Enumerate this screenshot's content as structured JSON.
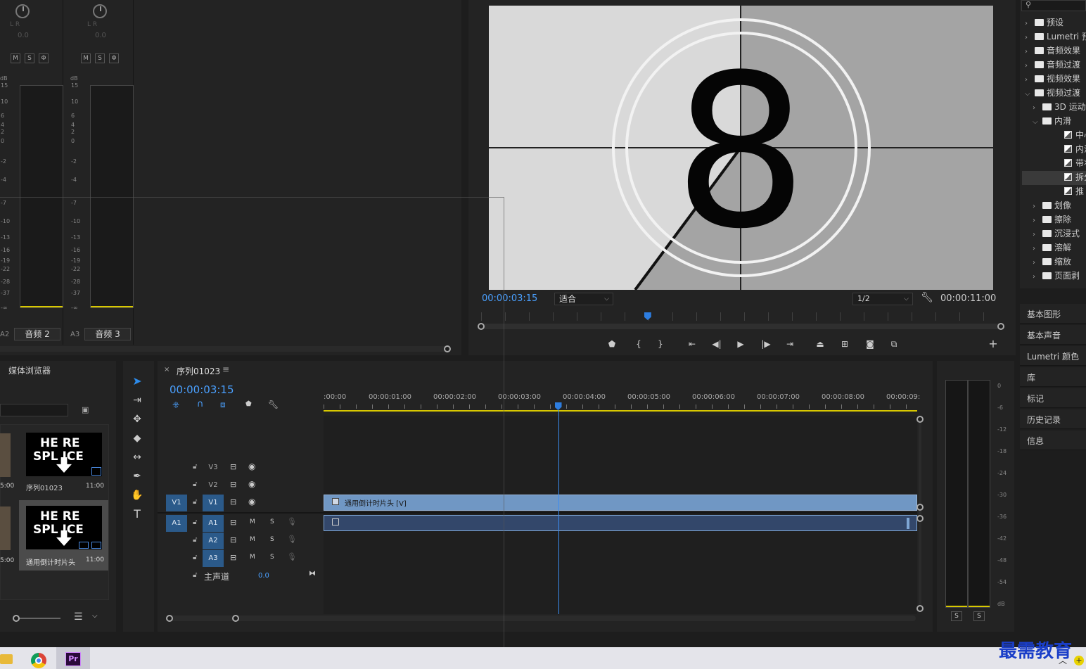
{
  "audio_mixer": {
    "channels": [
      {
        "label": "音频 2",
        "track": "A2",
        "lr": "L  R",
        "value": "0.0",
        "m": "M",
        "s": "S",
        "r": "Φ"
      },
      {
        "label": "音频 3",
        "track": "A3",
        "lr": "L  R",
        "value": "0.0",
        "m": "M",
        "s": "S",
        "r": "Φ"
      }
    ],
    "db_label": "dB",
    "db_scale": [
      "15",
      "10",
      "6",
      "4",
      "2",
      "0",
      "-2",
      "-4",
      "-7",
      "-10",
      "-13",
      "-16",
      "-19",
      "-22",
      "-28",
      "-37",
      "-∞"
    ]
  },
  "program_monitor": {
    "countdown_number": "8",
    "current_timecode": "00:00:03:15",
    "fit_option": "适合",
    "resolution": "1/2",
    "duration": "00:00:11:00",
    "playhead_fraction": 0.32
  },
  "effects_panel": {
    "search_placeholder": "",
    "items": [
      {
        "label": "预设",
        "type": "folder",
        "level": 0,
        "open": false
      },
      {
        "label": "Lumetri 预",
        "type": "folder",
        "level": 0,
        "open": false
      },
      {
        "label": "音频效果",
        "type": "folder",
        "level": 0,
        "open": false
      },
      {
        "label": "音频过渡",
        "type": "folder",
        "level": 0,
        "open": false
      },
      {
        "label": "视频效果",
        "type": "folder",
        "level": 0,
        "open": false
      },
      {
        "label": "视频过渡",
        "type": "folder",
        "level": 0,
        "open": true
      },
      {
        "label": "3D 运动",
        "type": "folder",
        "level": 1,
        "open": false
      },
      {
        "label": "内滑",
        "type": "folder",
        "level": 1,
        "open": true
      },
      {
        "label": "中心",
        "type": "fx",
        "level": 2
      },
      {
        "label": "内滑",
        "type": "fx",
        "level": 2
      },
      {
        "label": "带状",
        "type": "fx",
        "level": 2
      },
      {
        "label": "拆分",
        "type": "fx",
        "level": 2,
        "selected": true
      },
      {
        "label": "推",
        "type": "fx",
        "level": 2
      },
      {
        "label": "划像",
        "type": "folder",
        "level": 1,
        "open": false
      },
      {
        "label": "擦除",
        "type": "folder",
        "level": 1,
        "open": false
      },
      {
        "label": "沉浸式",
        "type": "folder",
        "level": 1,
        "open": false
      },
      {
        "label": "溶解",
        "type": "folder",
        "level": 1,
        "open": false
      },
      {
        "label": "缩放",
        "type": "folder",
        "level": 1,
        "open": false
      },
      {
        "label": "页面剥",
        "type": "folder",
        "level": 1,
        "open": false
      }
    ],
    "panels": [
      "基本图形",
      "基本声音",
      "Lumetri 颜色",
      "库",
      "标记",
      "历史记录",
      "信息"
    ]
  },
  "media_browser": {
    "title": "媒体浏览器",
    "items": [
      {
        "name": "序列01023",
        "duration": "11:00",
        "side_duration": "5:00"
      },
      {
        "name": "通用倒计时片头",
        "duration": "11:00",
        "side_duration": "5:00"
      }
    ],
    "thumb_top": "HE RE",
    "thumb_bottom": "SPL ICE"
  },
  "timeline": {
    "sequence_name": "序列01023",
    "timecode": "00:00:03:15",
    "ruler": [
      ":00:00",
      "00:00:01:00",
      "00:00:02:00",
      "00:00:03:00",
      "00:00:04:00",
      "00:00:05:00",
      "00:00:06:00",
      "00:00:07:00",
      "00:00:08:00",
      "00:00:09:"
    ],
    "video_tracks": [
      {
        "name": "V3",
        "source": ""
      },
      {
        "name": "V2",
        "source": ""
      },
      {
        "name": "V1",
        "source": "V1"
      }
    ],
    "audio_tracks": [
      {
        "name": "A1",
        "source": "A1",
        "m": "M",
        "s": "S"
      },
      {
        "name": "A2",
        "source": "",
        "m": "M",
        "s": "S"
      },
      {
        "name": "A3",
        "source": "",
        "m": "M",
        "s": "S"
      }
    ],
    "master": {
      "label": "主声道",
      "value": "0.0"
    },
    "video_clip": "通用倒计时片头 [V]",
    "playhead_seconds": 3.625
  },
  "audio_meter": {
    "scale": [
      "0",
      "-6",
      "-12",
      "-18",
      "-24",
      "-30",
      "-36",
      "-42",
      "-48",
      "-54",
      "dB"
    ],
    "solo": [
      "S",
      "S"
    ]
  },
  "taskbar": {
    "pr_label": "Pr",
    "watermark": "最需教育"
  }
}
